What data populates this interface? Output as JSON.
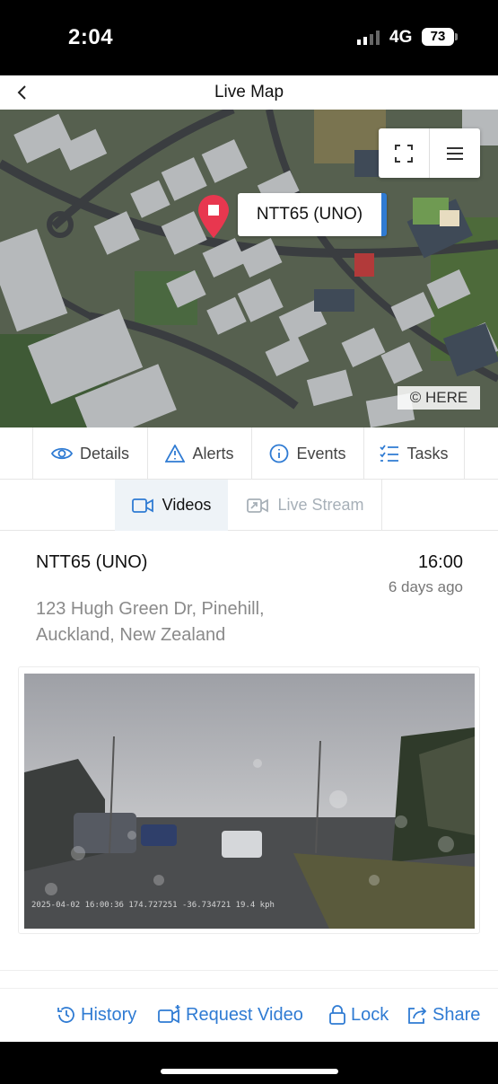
{
  "status_bar": {
    "time": "2:04",
    "network": "4G",
    "battery": "73"
  },
  "header": {
    "title": "Live Map",
    "back_icon": "chevron-left-icon"
  },
  "map": {
    "vehicle_label": "NTT65 (UNO)",
    "attribution": "© HERE",
    "controls": [
      "fullscreen-icon",
      "menu-icon"
    ],
    "accent_color": "#2f7bd3",
    "pin_color": "#e8374f"
  },
  "tabs": [
    {
      "label": "Details",
      "icon": "eye-icon"
    },
    {
      "label": "Alerts",
      "icon": "warning-icon"
    },
    {
      "label": "Events",
      "icon": "info-icon"
    },
    {
      "label": "Tasks",
      "icon": "checklist-icon"
    }
  ],
  "subtabs": [
    {
      "label": "Videos",
      "icon": "video-camera-icon",
      "active": true
    },
    {
      "label": "Live Stream",
      "icon": "live-stream-icon",
      "active": false
    }
  ],
  "event": {
    "vehicle_name": "NTT65 (UNO)",
    "time": "16:00",
    "ago": "6 days ago",
    "address": "123 Hugh Green Dr, Pinehill, Auckland, New Zealand",
    "video_overlay": "2025-04-02 16:00:36   174.727251 -36.734721   19.4 kph"
  },
  "actions": [
    {
      "label": "History",
      "icon": "history-icon"
    },
    {
      "label": "Request Video",
      "icon": "request-video-icon"
    },
    {
      "label": "Lock",
      "icon": "lock-icon"
    },
    {
      "label": "Share",
      "icon": "share-icon"
    }
  ]
}
